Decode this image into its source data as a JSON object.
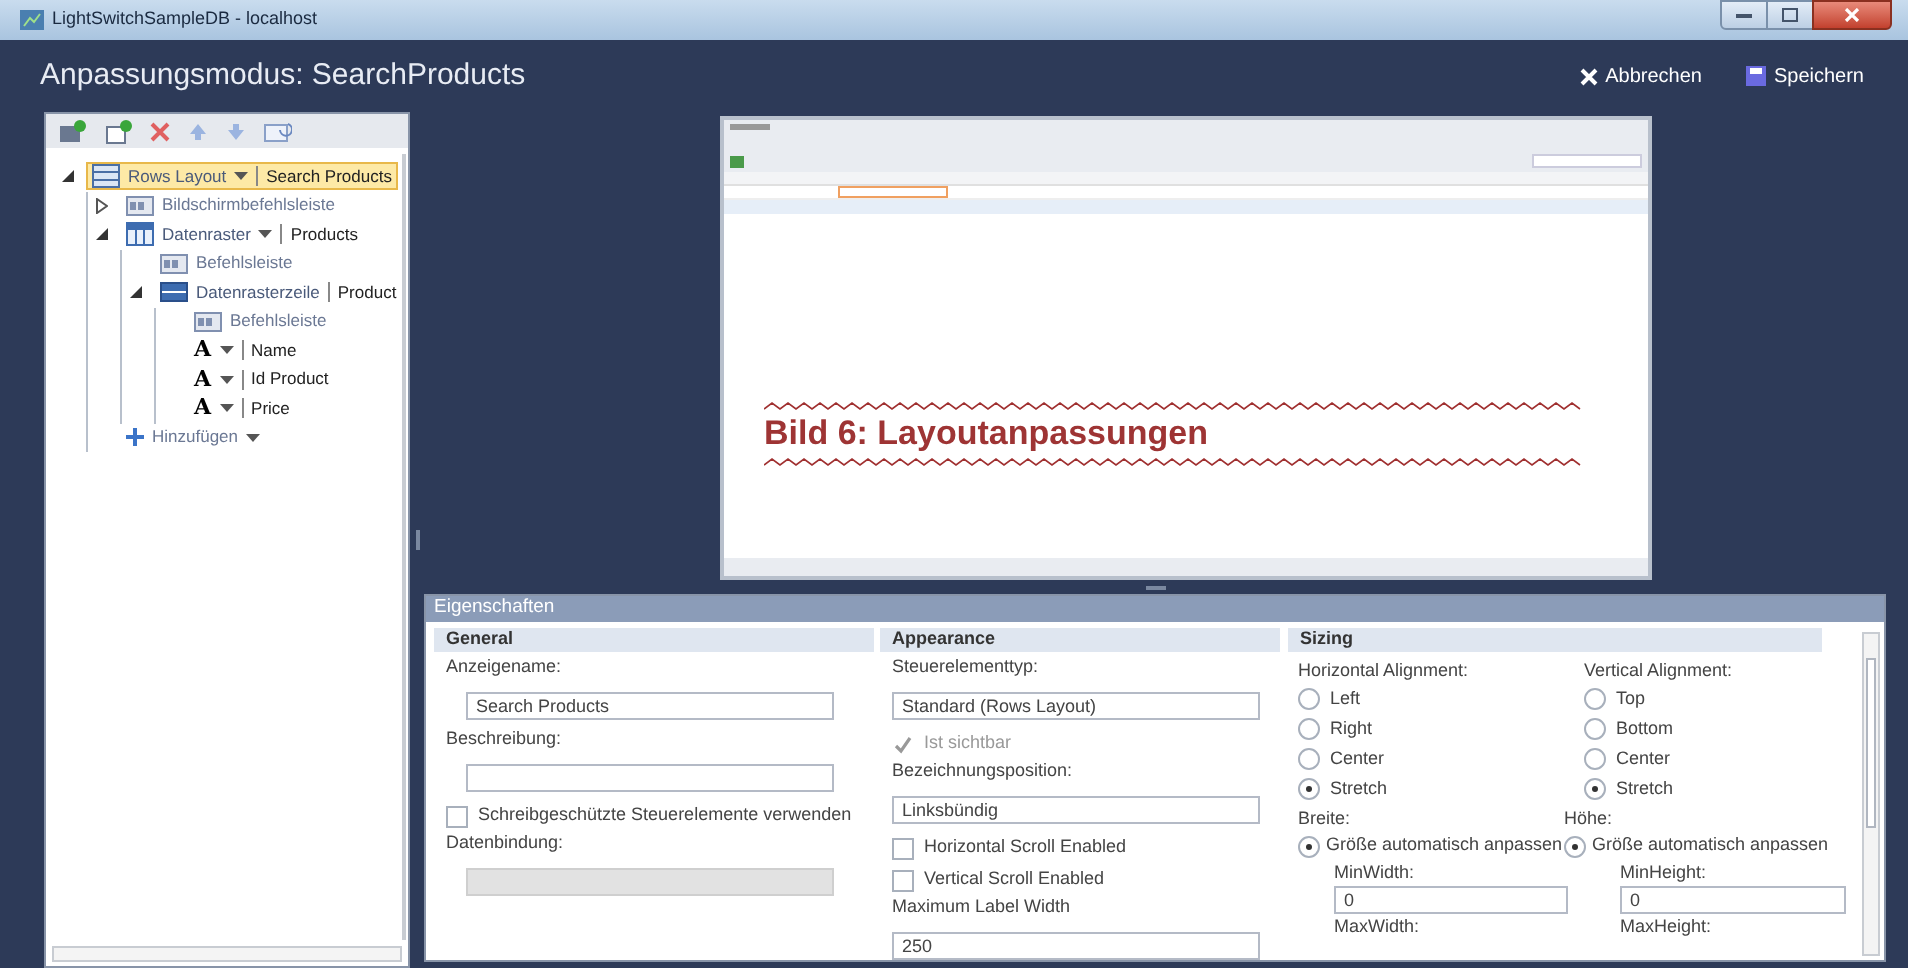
{
  "window": {
    "title": "LightSwitchSampleDB - localhost"
  },
  "header": {
    "title": "Anpassungsmodus: SearchProducts",
    "actions": [
      {
        "kind": "cancel",
        "label": "Abbrechen"
      },
      {
        "kind": "save",
        "label": "Speichern"
      }
    ]
  },
  "tree": [
    {
      "kind": "layout",
      "label": "Rows Layout",
      "dropdown": true,
      "value": "Search Products",
      "selected": true,
      "expanded": true,
      "children": [
        {
          "kind": "commandbar",
          "label": "Bildschirmbefehlsleiste",
          "expanded": false,
          "selected": false
        },
        {
          "kind": "grid",
          "label": "Datenraster",
          "dropdown": true,
          "value": "Products",
          "expanded": true,
          "selected": false,
          "children": [
            {
              "kind": "commandbar",
              "label": "Befehlsleiste",
              "selected": false
            },
            {
              "kind": "row",
              "label": "Datenrasterzeile",
              "value": "Product",
              "expanded": true,
              "selected": false,
              "children": [
                {
                  "kind": "commandbar",
                  "label": "Befehlsleiste",
                  "selected": false
                },
                {
                  "kind": "text",
                  "label": "A",
                  "dropdown": true,
                  "value": "Name",
                  "selected": false
                },
                {
                  "kind": "text",
                  "label": "A",
                  "dropdown": true,
                  "value": "Id Product",
                  "selected": false
                },
                {
                  "kind": "text",
                  "label": "A",
                  "dropdown": true,
                  "value": "Price",
                  "selected": false
                }
              ]
            }
          ]
        },
        {
          "kind": "add",
          "label": "Hinzufügen",
          "dropdown": true,
          "selected": false
        }
      ]
    }
  ],
  "preview": {
    "caption": "Bild 6: Layoutanpassungen"
  },
  "properties": {
    "title": "Eigenschaften",
    "general": {
      "title": "General",
      "items": [
        {
          "kind": "field",
          "label": "Anzeigename:",
          "value": "Search Products",
          "disabled": false
        },
        {
          "kind": "field",
          "label": "Beschreibung:",
          "value": "",
          "disabled": false
        },
        {
          "kind": "checkbox",
          "label": "Schreibgeschützte Steuerelemente verwenden",
          "checked": false,
          "disabled": false
        },
        {
          "kind": "field",
          "label": "Datenbindung:",
          "value": "",
          "disabled": true
        }
      ]
    },
    "appearance": {
      "title": "Appearance",
      "items": [
        {
          "kind": "field",
          "label": "Steuerelementtyp:",
          "value": "Standard (Rows Layout)",
          "disabled": false
        },
        {
          "kind": "checkbox",
          "label": "Ist sichtbar",
          "checked": true,
          "disabled": true
        },
        {
          "kind": "field",
          "label": "Bezeichnungsposition:",
          "value": "Linksbündig",
          "disabled": false
        },
        {
          "kind": "checkbox",
          "label": "Horizontal Scroll Enabled",
          "checked": false,
          "disabled": false
        },
        {
          "kind": "checkbox",
          "label": "Vertical Scroll Enabled",
          "checked": false,
          "disabled": false
        },
        {
          "kind": "field",
          "label": "Maximum Label Width",
          "value": "250",
          "disabled": false
        }
      ]
    },
    "sizing": {
      "title": "Sizing",
      "columns": [
        {
          "label": "Horizontal Alignment:",
          "options": [
            {
              "label": "Left",
              "selected": false
            },
            {
              "label": "Right",
              "selected": false
            },
            {
              "label": "Center",
              "selected": false
            },
            {
              "label": "Stretch",
              "selected": true
            }
          ],
          "size_label": "Breite:",
          "size_option": {
            "label": "Größe automatisch anpassen",
            "selected": true
          },
          "min_label": "MinWidth:",
          "min_value": "0",
          "max_label": "MaxWidth:"
        },
        {
          "label": "Vertical Alignment:",
          "options": [
            {
              "label": "Top",
              "selected": false
            },
            {
              "label": "Bottom",
              "selected": false
            },
            {
              "label": "Center",
              "selected": false
            },
            {
              "label": "Stretch",
              "selected": true
            }
          ],
          "size_label": "Höhe:",
          "size_option": {
            "label": "Größe automatisch anpassen",
            "selected": true
          },
          "min_label": "MinHeight:",
          "min_value": "0",
          "max_label": "MaxHeight:"
        }
      ]
    }
  }
}
